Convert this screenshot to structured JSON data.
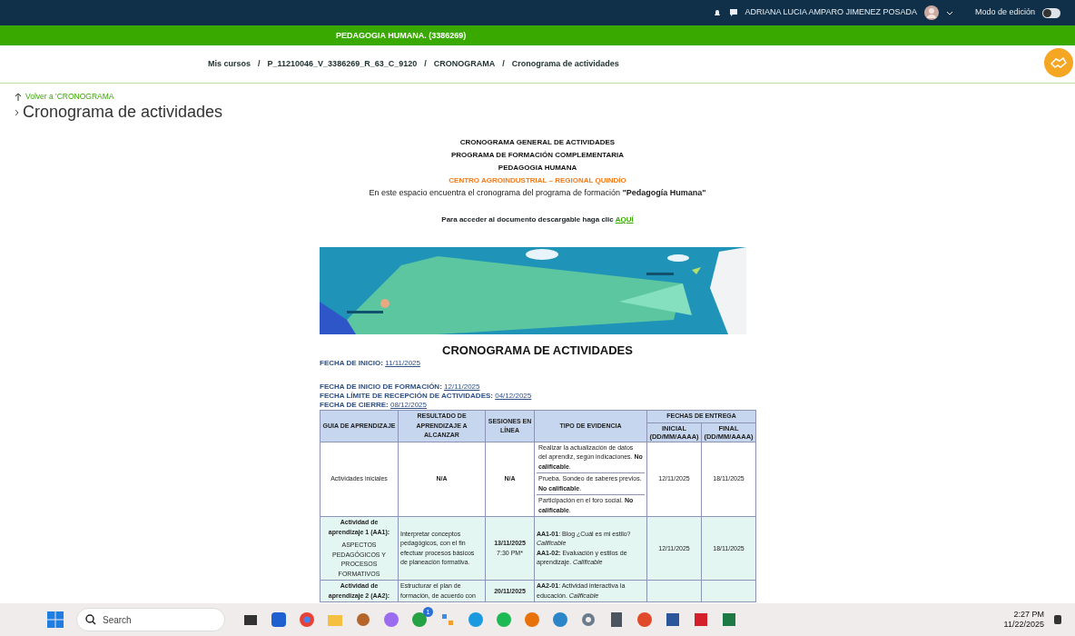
{
  "topbar": {
    "user_name": "ADRIANA LUCIA AMPARO JIMENEZ POSADA",
    "edit_mode_label": "Modo de edición",
    "edit_mode_on": false
  },
  "course_bar": {
    "title": "PEDAGOGIA HUMANA. (3386269)"
  },
  "breadcrumb": {
    "separator": "/",
    "items": [
      "Mis cursos",
      "P_11210046_V_3386269_R_63_C_9120",
      "CRONOGRAMA",
      "Cronograma de actividades"
    ]
  },
  "back_link": "Volver a 'CRONOGRAMA",
  "page_title": "Cronograma de actividades",
  "content": {
    "headings": [
      {
        "text": "CRONOGRAMA GENERAL DE ACTIVIDADES",
        "kind": "plain"
      },
      {
        "text": "PROGRAMA DE FORMACIÓN COMPLEMENTARIA",
        "kind": "plain"
      },
      {
        "text": "PEDAGOGIA HUMANA",
        "kind": "plain"
      },
      {
        "text": "CENTRO AGROINDUSTRIAL – REGIONAL QUINDÍO",
        "kind": "accent"
      }
    ],
    "intro": "En este espacio encuentra el cronograma del programa de formación **\"Pedagogía Humana\"**",
    "download_text": "Para acceder al documento descargable haga clic",
    "download_link": "AQUÍ",
    "banner": {
      "kind": "picture"
    },
    "schedule_title": "CRONOGRAMA DE ACTIVIDADES",
    "date_groups": [
      [
        {
          "label": "FECHA DE INICIO:",
          "value": "11/11/2025"
        }
      ],
      [
        {
          "label": "FECHA DE INICIO DE FORMACIÓN:",
          "value": "12/11/2025"
        },
        {
          "label": "FECHA LÍMITE DE RECEPCIÓN DE ACTIVIDADES:",
          "value": "04/12/2025"
        },
        {
          "label": "FECHA DE CIERRE:",
          "value": "08/12/2025"
        }
      ]
    ],
    "table": {
      "columns": [
        "GUIA DE APRENDIZAJE",
        "RESULTADO DE APRENDIZAJE A ALCANZAR",
        "SESIONES EN LÍNEA",
        "TIPO DE EVIDENCIA"
      ],
      "delivery_header": "FECHAS DE ENTREGA",
      "delivery_columns": [
        {
          "label": "INICIAL",
          "format": "(DD/MM/AAAA)"
        },
        {
          "label": "FINAL",
          "format": "(DD/MM/AAAA)"
        }
      ],
      "rows": [
        {
          "kind": "initial",
          "guide": "Actividades iniciales",
          "result": "N/A",
          "session": "N/A",
          "evidences": [
            "Realizar la actualización de datos del aprendiz, según indicaciones. **No calificable**.",
            "Prueba. Sondeo de saberes previos. **No calificable**.",
            "Participación en el foro social. **No calificable**."
          ],
          "start": "12/11/2025",
          "end": "18/11/2025"
        },
        {
          "kind": "activity",
          "guide": "Actividad de aprendizaje 1 (AA1):",
          "guide_detail": "ASPECTOS PEDAGÓGICOS Y PROCESOS FORMATIVOS",
          "result": "Interpretar conceptos pedagógicos, con el fin efectuar procesos básicos de planeación formativa.",
          "session": "13/11/2025",
          "session_time": "7:30 PM*",
          "evidences": [
            "**AA1-01**: Blog ¿Cuál es mi estilo? *Calificable*",
            "**AA1-02:** Evaluación y estilos de aprendizaje. *Calificable*"
          ],
          "start": "12/11/2025",
          "end": "18/11/2025"
        },
        {
          "kind": "activity",
          "guide": "Actividad de aprendizaje 2 (AA2):",
          "result": "Estructurar el plan de formación, de acuerdo con",
          "session": "20/11/2025",
          "evidences": [
            "**AA2-01**: Actividad interactiva la educación. *Calificable*"
          ]
        }
      ]
    }
  },
  "taskbar": {
    "search_placeholder": "Search",
    "chat_badge": "1",
    "time": "2:27 PM",
    "date": "11/22/2025"
  }
}
